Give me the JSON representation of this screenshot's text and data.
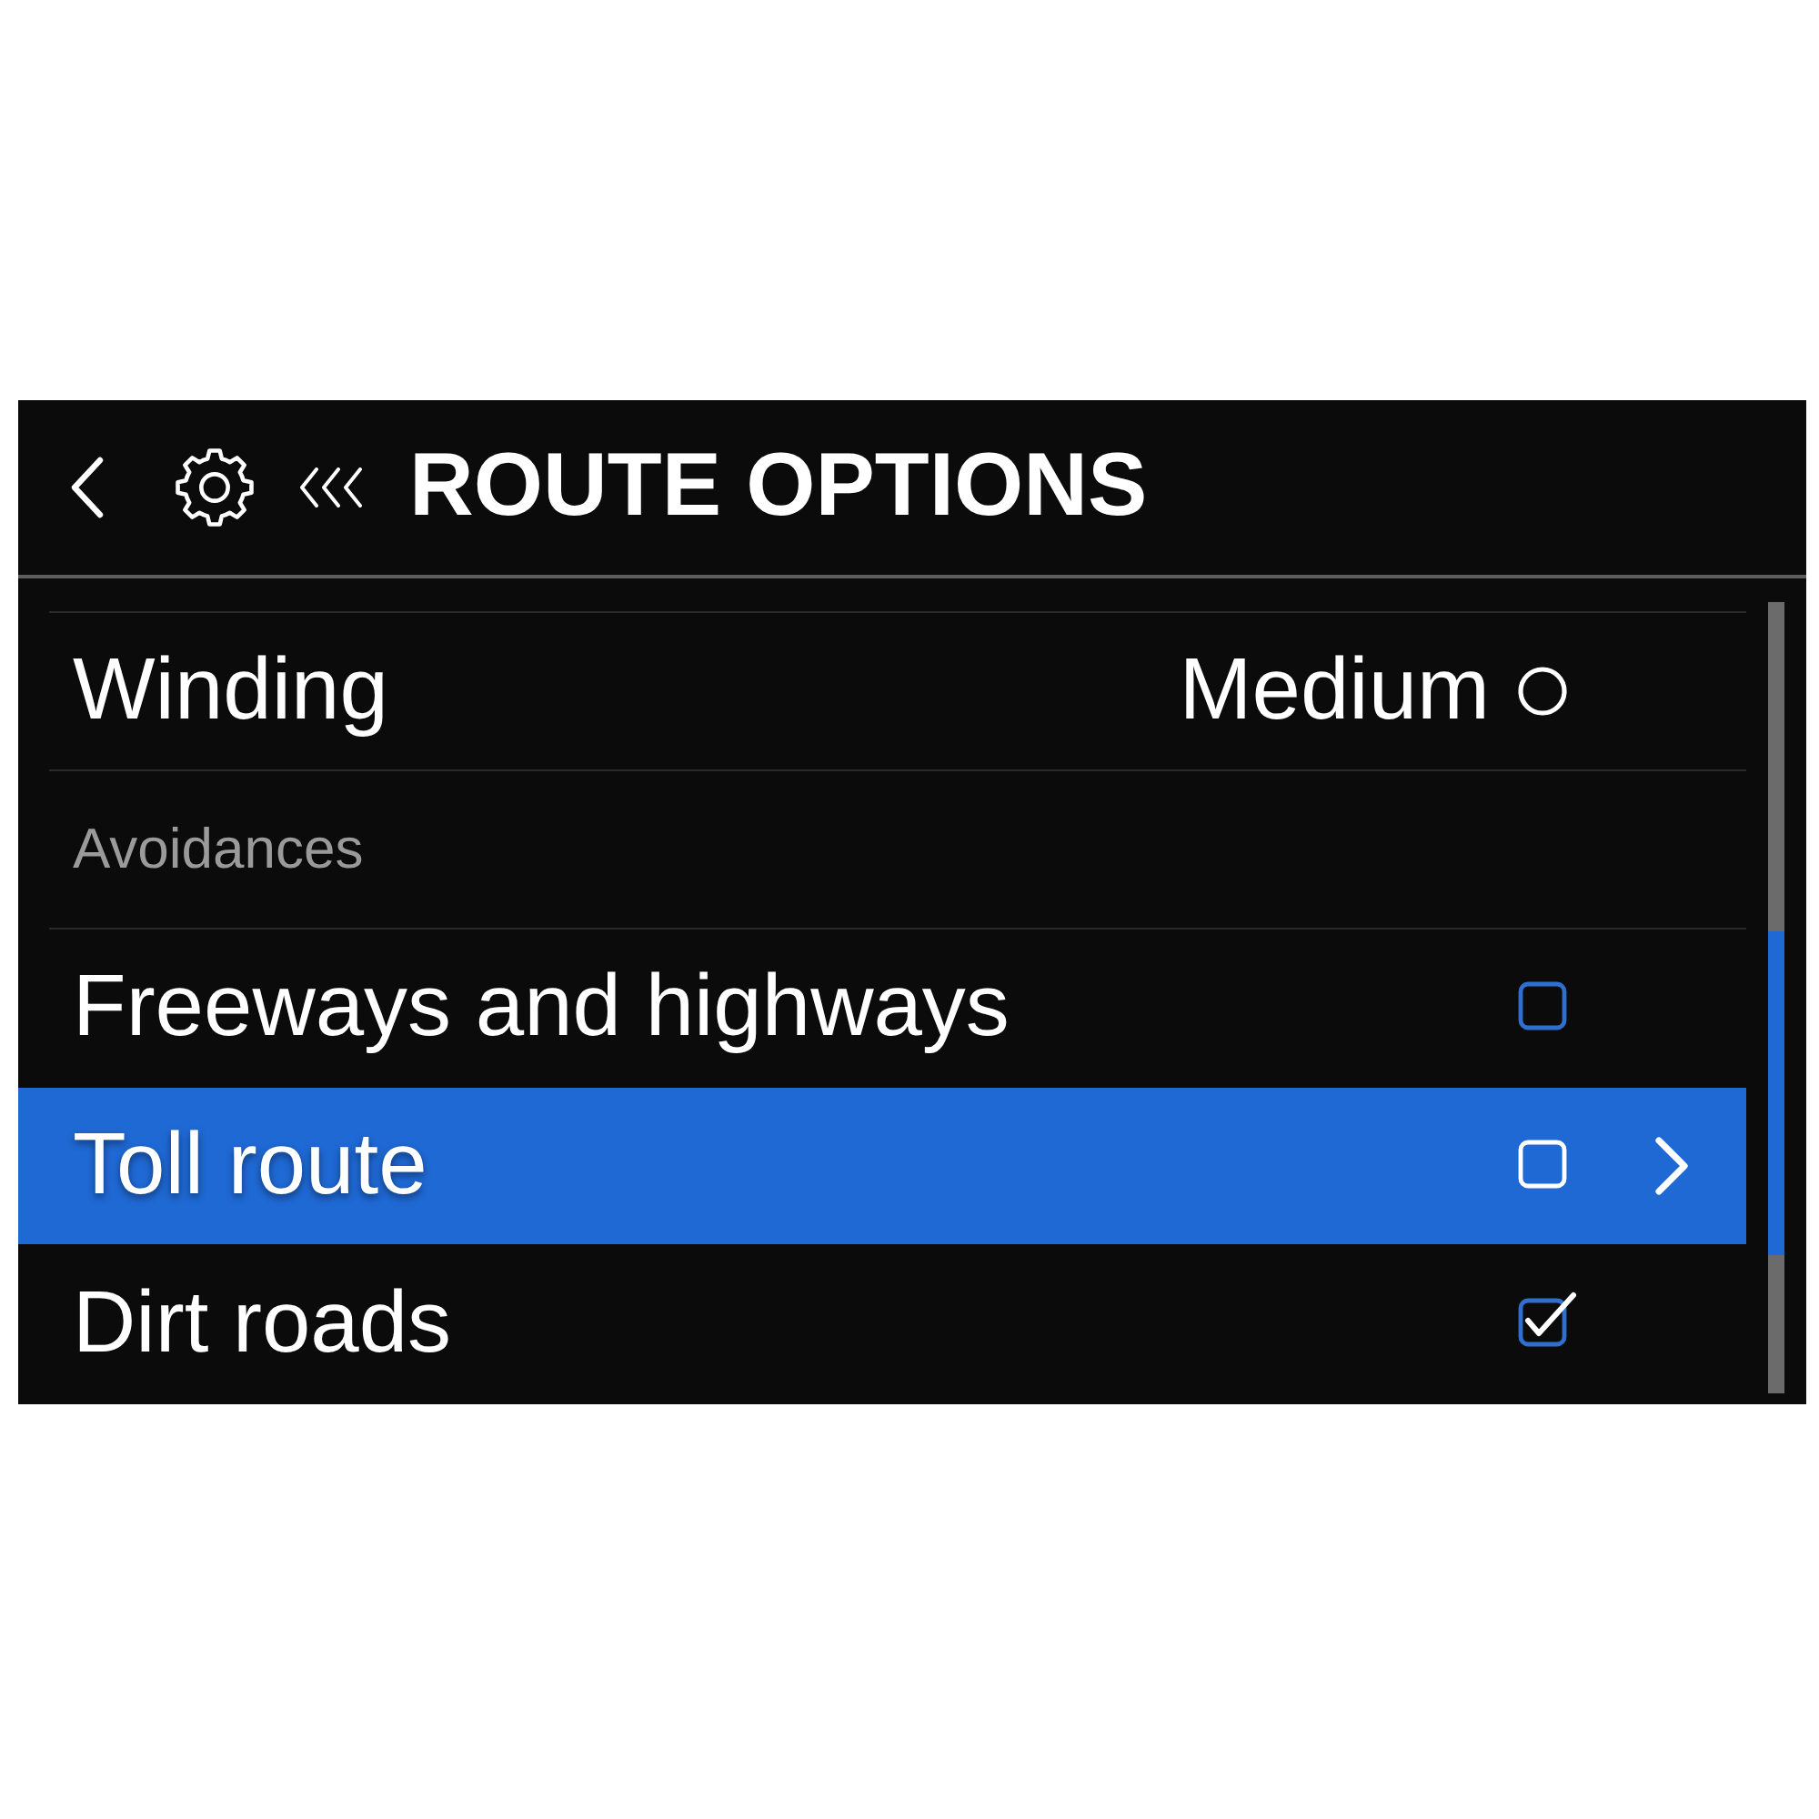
{
  "header": {
    "title": "ROUTE OPTIONS"
  },
  "list": [
    {
      "kind": "value",
      "label": "Winding",
      "value": "Medium",
      "selected": false
    },
    {
      "kind": "section",
      "label": "Avoidances"
    },
    {
      "kind": "checkbox",
      "label": "Freeways and highways",
      "checked": false,
      "selected": false
    },
    {
      "kind": "checkbox",
      "label": "Toll route",
      "checked": false,
      "selected": true
    },
    {
      "kind": "checkbox",
      "label": "Dirt roads",
      "checked": true,
      "selected": false
    }
  ]
}
